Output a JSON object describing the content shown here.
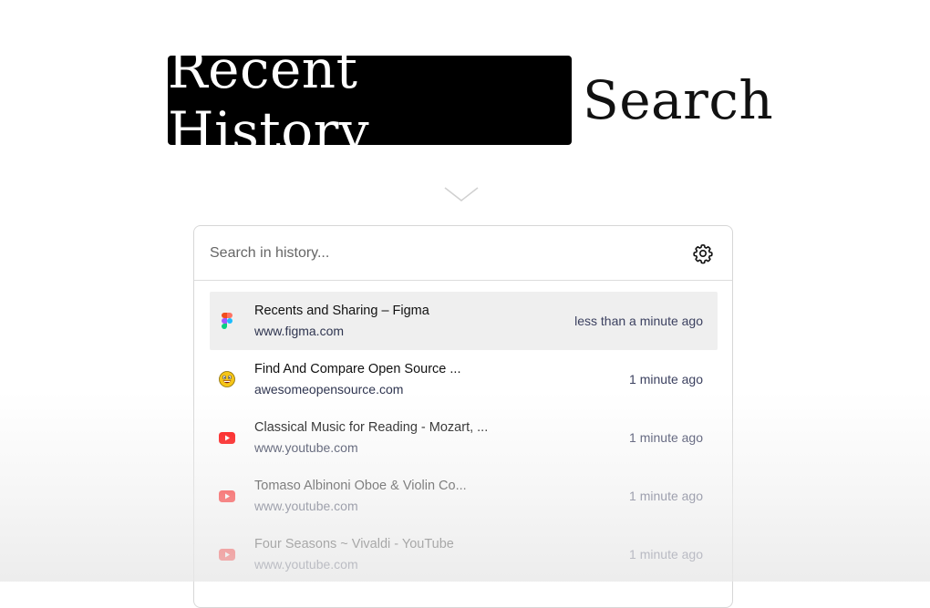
{
  "header": {
    "title_highlight": "Recent History",
    "title_rest": "Search"
  },
  "search": {
    "placeholder": "Search in history..."
  },
  "history": [
    {
      "title": "Recents and Sharing – Figma",
      "url": "www.figma.com",
      "time": "less than a minute ago",
      "icon": "figma-icon"
    },
    {
      "title": "Find And Compare Open Source ...",
      "url": "awesomeopensource.com",
      "time": "1 minute ago",
      "icon": "emoji-face-icon"
    },
    {
      "title": "Classical Music for Reading - Mozart, ...",
      "url": "www.youtube.com",
      "time": "1 minute ago",
      "icon": "youtube-icon"
    },
    {
      "title": "Tomaso Albinoni Oboe & Violin Co...",
      "url": "www.youtube.com",
      "time": "1 minute ago",
      "icon": "youtube-icon"
    },
    {
      "title": "Four Seasons ~ Vivaldi - YouTube",
      "url": "www.youtube.com",
      "time": "1 minute ago",
      "icon": "youtube-icon"
    }
  ],
  "colors": {
    "youtube_red": "#ff0000",
    "highlight_bg": "#000000",
    "active_row_bg": "#efefef"
  }
}
